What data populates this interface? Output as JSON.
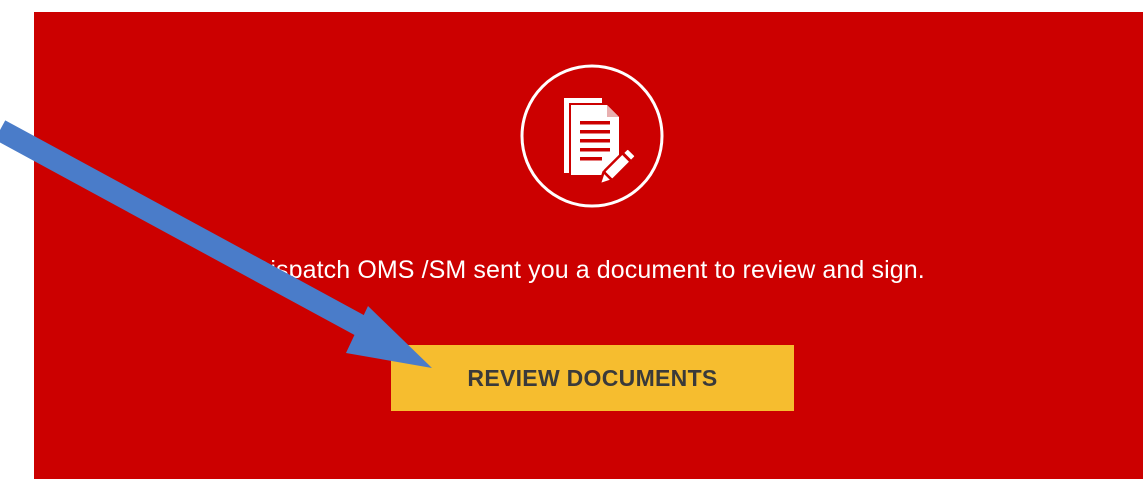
{
  "email_card": {
    "message": "Dispatch OMS /SM sent you a document to review and sign.",
    "button_label": "REVIEW DOCUMENTS",
    "icon": "document-sign-icon"
  },
  "annotation": {
    "icon": "blue-arrow-pointer"
  },
  "colors": {
    "banner_bg": "#cc0000",
    "button_bg": "#f6bd2f",
    "button_text": "#3a3a3a",
    "arrow": "#4a7cc9"
  }
}
